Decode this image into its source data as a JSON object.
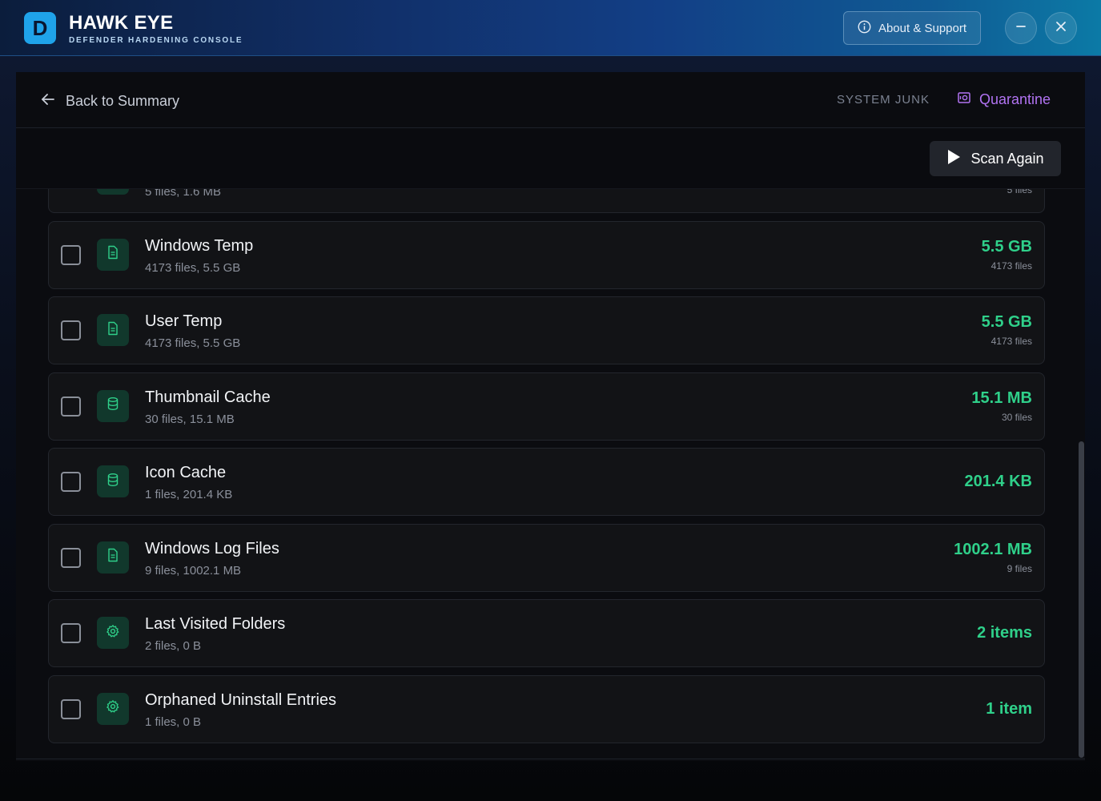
{
  "app": {
    "logo_letter": "D",
    "title": "HAWK EYE",
    "subtitle": "DEFENDER HARDENING CONSOLE",
    "about_label": "About & Support"
  },
  "header": {
    "back_label": "Back to Summary",
    "category": "SYSTEM JUNK",
    "quarantine_label": "Quarantine"
  },
  "toolbar": {
    "scan_label": "Scan Again"
  },
  "colors": {
    "accent_green": "#2fd08a",
    "accent_purple": "#b173f2",
    "logo_blue": "#1fa3ea"
  },
  "items": [
    {
      "name": "",
      "meta": "5 files, 1.6 MB",
      "size": "",
      "count": "5 files",
      "icon": "file-icon"
    },
    {
      "name": "Windows Temp",
      "meta": "4173 files, 5.5 GB",
      "size": "5.5 GB",
      "count": "4173 files",
      "icon": "file-icon"
    },
    {
      "name": "User Temp",
      "meta": "4173 files, 5.5 GB",
      "size": "5.5 GB",
      "count": "4173 files",
      "icon": "file-icon"
    },
    {
      "name": "Thumbnail Cache",
      "meta": "30 files, 15.1 MB",
      "size": "15.1 MB",
      "count": "30 files",
      "icon": "database-icon"
    },
    {
      "name": "Icon Cache",
      "meta": "1 files, 201.4 KB",
      "size": "201.4 KB",
      "count": "",
      "icon": "database-icon"
    },
    {
      "name": "Windows Log Files",
      "meta": "9 files, 1002.1 MB",
      "size": "1002.1 MB",
      "count": "9 files",
      "icon": "file-icon"
    },
    {
      "name": "Last Visited Folders",
      "meta": "2 files, 0 B",
      "size": "2 items",
      "count": "",
      "icon": "gear-icon"
    },
    {
      "name": "Orphaned Uninstall Entries",
      "meta": "1 files, 0 B",
      "size": "1 item",
      "count": "",
      "icon": "gear-icon"
    }
  ]
}
